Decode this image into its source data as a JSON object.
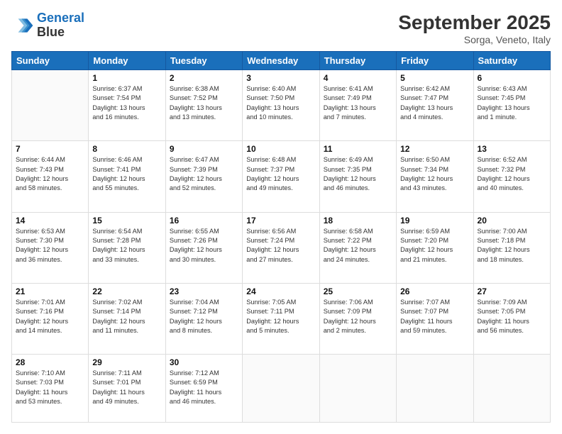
{
  "header": {
    "logo_line1": "General",
    "logo_line2": "Blue",
    "month": "September 2025",
    "location": "Sorga, Veneto, Italy"
  },
  "weekdays": [
    "Sunday",
    "Monday",
    "Tuesday",
    "Wednesday",
    "Thursday",
    "Friday",
    "Saturday"
  ],
  "weeks": [
    [
      {
        "day": "",
        "info": ""
      },
      {
        "day": "1",
        "info": "Sunrise: 6:37 AM\nSunset: 7:54 PM\nDaylight: 13 hours\nand 16 minutes."
      },
      {
        "day": "2",
        "info": "Sunrise: 6:38 AM\nSunset: 7:52 PM\nDaylight: 13 hours\nand 13 minutes."
      },
      {
        "day": "3",
        "info": "Sunrise: 6:40 AM\nSunset: 7:50 PM\nDaylight: 13 hours\nand 10 minutes."
      },
      {
        "day": "4",
        "info": "Sunrise: 6:41 AM\nSunset: 7:49 PM\nDaylight: 13 hours\nand 7 minutes."
      },
      {
        "day": "5",
        "info": "Sunrise: 6:42 AM\nSunset: 7:47 PM\nDaylight: 13 hours\nand 4 minutes."
      },
      {
        "day": "6",
        "info": "Sunrise: 6:43 AM\nSunset: 7:45 PM\nDaylight: 13 hours\nand 1 minute."
      }
    ],
    [
      {
        "day": "7",
        "info": "Sunrise: 6:44 AM\nSunset: 7:43 PM\nDaylight: 12 hours\nand 58 minutes."
      },
      {
        "day": "8",
        "info": "Sunrise: 6:46 AM\nSunset: 7:41 PM\nDaylight: 12 hours\nand 55 minutes."
      },
      {
        "day": "9",
        "info": "Sunrise: 6:47 AM\nSunset: 7:39 PM\nDaylight: 12 hours\nand 52 minutes."
      },
      {
        "day": "10",
        "info": "Sunrise: 6:48 AM\nSunset: 7:37 PM\nDaylight: 12 hours\nand 49 minutes."
      },
      {
        "day": "11",
        "info": "Sunrise: 6:49 AM\nSunset: 7:35 PM\nDaylight: 12 hours\nand 46 minutes."
      },
      {
        "day": "12",
        "info": "Sunrise: 6:50 AM\nSunset: 7:34 PM\nDaylight: 12 hours\nand 43 minutes."
      },
      {
        "day": "13",
        "info": "Sunrise: 6:52 AM\nSunset: 7:32 PM\nDaylight: 12 hours\nand 40 minutes."
      }
    ],
    [
      {
        "day": "14",
        "info": "Sunrise: 6:53 AM\nSunset: 7:30 PM\nDaylight: 12 hours\nand 36 minutes."
      },
      {
        "day": "15",
        "info": "Sunrise: 6:54 AM\nSunset: 7:28 PM\nDaylight: 12 hours\nand 33 minutes."
      },
      {
        "day": "16",
        "info": "Sunrise: 6:55 AM\nSunset: 7:26 PM\nDaylight: 12 hours\nand 30 minutes."
      },
      {
        "day": "17",
        "info": "Sunrise: 6:56 AM\nSunset: 7:24 PM\nDaylight: 12 hours\nand 27 minutes."
      },
      {
        "day": "18",
        "info": "Sunrise: 6:58 AM\nSunset: 7:22 PM\nDaylight: 12 hours\nand 24 minutes."
      },
      {
        "day": "19",
        "info": "Sunrise: 6:59 AM\nSunset: 7:20 PM\nDaylight: 12 hours\nand 21 minutes."
      },
      {
        "day": "20",
        "info": "Sunrise: 7:00 AM\nSunset: 7:18 PM\nDaylight: 12 hours\nand 18 minutes."
      }
    ],
    [
      {
        "day": "21",
        "info": "Sunrise: 7:01 AM\nSunset: 7:16 PM\nDaylight: 12 hours\nand 14 minutes."
      },
      {
        "day": "22",
        "info": "Sunrise: 7:02 AM\nSunset: 7:14 PM\nDaylight: 12 hours\nand 11 minutes."
      },
      {
        "day": "23",
        "info": "Sunrise: 7:04 AM\nSunset: 7:12 PM\nDaylight: 12 hours\nand 8 minutes."
      },
      {
        "day": "24",
        "info": "Sunrise: 7:05 AM\nSunset: 7:11 PM\nDaylight: 12 hours\nand 5 minutes."
      },
      {
        "day": "25",
        "info": "Sunrise: 7:06 AM\nSunset: 7:09 PM\nDaylight: 12 hours\nand 2 minutes."
      },
      {
        "day": "26",
        "info": "Sunrise: 7:07 AM\nSunset: 7:07 PM\nDaylight: 11 hours\nand 59 minutes."
      },
      {
        "day": "27",
        "info": "Sunrise: 7:09 AM\nSunset: 7:05 PM\nDaylight: 11 hours\nand 56 minutes."
      }
    ],
    [
      {
        "day": "28",
        "info": "Sunrise: 7:10 AM\nSunset: 7:03 PM\nDaylight: 11 hours\nand 53 minutes."
      },
      {
        "day": "29",
        "info": "Sunrise: 7:11 AM\nSunset: 7:01 PM\nDaylight: 11 hours\nand 49 minutes."
      },
      {
        "day": "30",
        "info": "Sunrise: 7:12 AM\nSunset: 6:59 PM\nDaylight: 11 hours\nand 46 minutes."
      },
      {
        "day": "",
        "info": ""
      },
      {
        "day": "",
        "info": ""
      },
      {
        "day": "",
        "info": ""
      },
      {
        "day": "",
        "info": ""
      }
    ]
  ]
}
